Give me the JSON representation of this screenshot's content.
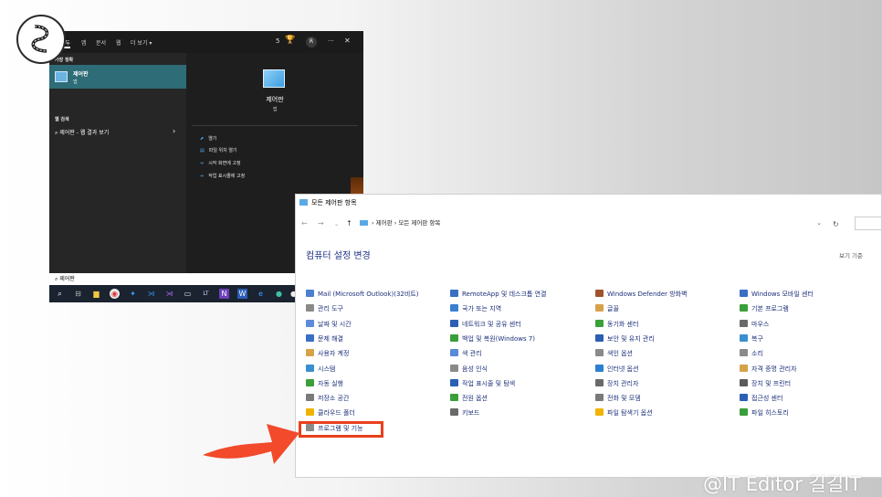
{
  "start_menu": {
    "tabs": [
      "모두",
      "앱",
      "문서",
      "웹",
      "더 보기 ▾"
    ],
    "top_count": "5",
    "avatar_letter": "R",
    "more": "···",
    "close": "✕",
    "best_match_section": "가장 정확",
    "best_match_name": "제어판",
    "best_match_sub": "앱",
    "web_section": "웹 검색",
    "web_item": "제어판 - 웹 결과 보기",
    "web_chevron": "›",
    "preview_title": "제어판",
    "preview_sub": "앱",
    "actions": [
      {
        "icon": "open-icon",
        "label": "열기"
      },
      {
        "icon": "folder-icon",
        "label": "파일 위치 열기"
      },
      {
        "icon": "pin-icon",
        "label": "시작 화면에 고정"
      },
      {
        "icon": "pin-icon",
        "label": "작업 표시줄에 고정"
      }
    ],
    "search_value": "제어판"
  },
  "control_panel": {
    "window_title": "모든 제어판 항목",
    "breadcrumb": [
      "제어판",
      "모든 제어판 항목"
    ],
    "heading": "컴퓨터 설정 변경",
    "view_by": "보기 기준",
    "columns": [
      [
        {
          "label": "Mail (Microsoft Outlook)(32비트)",
          "color": "#4a7fd1"
        },
        {
          "label": "관리 도구",
          "color": "#8a8a8a"
        },
        {
          "label": "날짜 및 시간",
          "color": "#5b8bd9"
        },
        {
          "label": "문제 해결",
          "color": "#3a6fc4"
        },
        {
          "label": "사용자 계정",
          "color": "#d6a24a"
        },
        {
          "label": "시스템",
          "color": "#3a8fd0"
        },
        {
          "label": "자동 실행",
          "color": "#3a9f3a"
        },
        {
          "label": "저장소 공간",
          "color": "#7a7a7a"
        },
        {
          "label": "클라우드 폴더",
          "color": "#f0b400"
        },
        {
          "label": "프로그램 및 기능",
          "color": "#8a8a8a"
        }
      ],
      [
        {
          "label": "RemoteApp 및 데스크톱 연결",
          "color": "#3a6fc4"
        },
        {
          "label": "국가 또는 지역",
          "color": "#3a7fd0"
        },
        {
          "label": "네트워크 및 공유 센터",
          "color": "#2a5fb4"
        },
        {
          "label": "백업 및 복원(Windows 7)",
          "color": "#3a9f3a"
        },
        {
          "label": "색 관리",
          "color": "#5a8ad9"
        },
        {
          "label": "음성 인식",
          "color": "#8a8a8a"
        },
        {
          "label": "작업 표시줄 및 탐색",
          "color": "#2a5fb4"
        },
        {
          "label": "전원 옵션",
          "color": "#3a9f3a"
        },
        {
          "label": "키보드",
          "color": "#6a6a6a"
        }
      ],
      [
        {
          "label": "Windows Defender 방화벽",
          "color": "#a0522d"
        },
        {
          "label": "글꼴",
          "color": "#d6a24a"
        },
        {
          "label": "동기화 센터",
          "color": "#3aa03a"
        },
        {
          "label": "보안 및 유지 관리",
          "color": "#2a5fb4"
        },
        {
          "label": "색인 옵션",
          "color": "#8a8a8a"
        },
        {
          "label": "인터넷 옵션",
          "color": "#2a7fd0"
        },
        {
          "label": "장치 관리자",
          "color": "#6a6a6a"
        },
        {
          "label": "전화 및 모뎀",
          "color": "#7a7a7a"
        },
        {
          "label": "파일 탐색기 옵션",
          "color": "#f0b400"
        }
      ],
      [
        {
          "label": "Windows 모바일 센터",
          "color": "#3a6fc4"
        },
        {
          "label": "기본 프로그램",
          "color": "#3a9f3a"
        },
        {
          "label": "마우스",
          "color": "#6a6a6a"
        },
        {
          "label": "복구",
          "color": "#3a8fd0"
        },
        {
          "label": "소리",
          "color": "#8a8a8a"
        },
        {
          "label": "자격 증명 관리자",
          "color": "#d6a24a"
        },
        {
          "label": "장치 및 프린터",
          "color": "#5a5a5a"
        },
        {
          "label": "접근성 센터",
          "color": "#2a5fb4"
        },
        {
          "label": "파일 히스토리",
          "color": "#3a9f3a"
        }
      ]
    ]
  },
  "annotation_color": "#e8401c",
  "watermark": "@IT Editor 길길IT"
}
